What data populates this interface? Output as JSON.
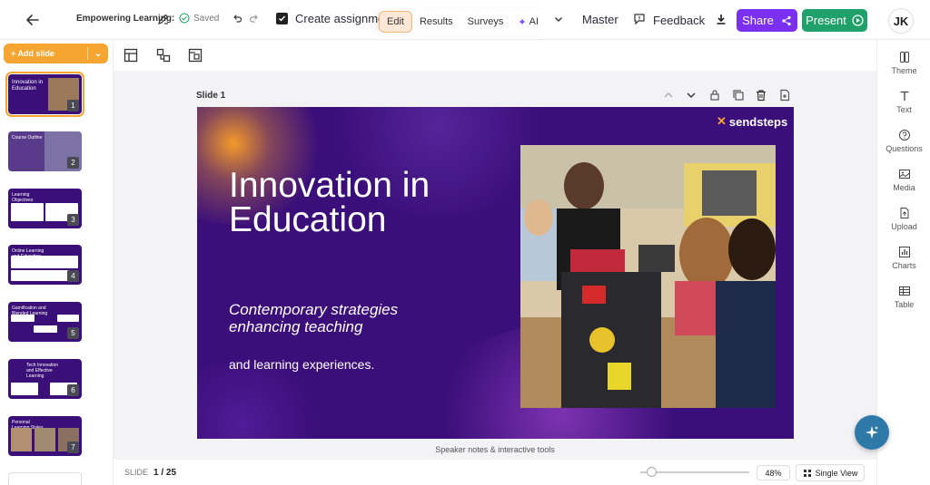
{
  "header": {
    "title": "Empowering Learning:",
    "saved": "Saved",
    "create_assignment": "Create assignment",
    "tabs": [
      {
        "label": "Edit",
        "active": true
      },
      {
        "label": "Results",
        "active": false
      },
      {
        "label": "Surveys",
        "active": false
      },
      {
        "label": "AI",
        "active": false
      }
    ],
    "master": "Master",
    "feedback": "Feedback",
    "share": "Share",
    "present": "Present",
    "avatar_initials": "JK"
  },
  "sidebar": {
    "add_slide": "Add slide",
    "slides": [
      {
        "number": "1",
        "title": "Innovation in Education",
        "selected": true
      },
      {
        "number": "2",
        "title": "Course Outline",
        "selected": false
      },
      {
        "number": "3",
        "title": "Learning Objectives",
        "selected": false
      },
      {
        "number": "4",
        "title": "Online Learning and Education 4.0",
        "selected": false
      },
      {
        "number": "5",
        "title": "Gamification and Blended Learning",
        "selected": false
      },
      {
        "number": "6",
        "title": "Tech Innovation and Effective Learning",
        "selected": false
      },
      {
        "number": "7",
        "title": "Personal Learning Styles",
        "selected": false
      }
    ]
  },
  "slide": {
    "label": "Slide 1",
    "brand": "sendsteps",
    "title": "Innovation in Education",
    "subtitle": "Contemporary strategies enhancing teaching",
    "body": "and learning experiences.",
    "photo": "classroom-photo"
  },
  "footer": {
    "speaker_notes": "Speaker notes & interactive tools",
    "slide_label": "SLIDE",
    "slide_count": "1 / 25",
    "zoom": "48%",
    "zoom_level": 0.1,
    "view": "Single View"
  },
  "right_panel": {
    "items": [
      {
        "label": "Theme",
        "icon": "theme-icon"
      },
      {
        "label": "Text",
        "icon": "text-icon"
      },
      {
        "label": "Questions",
        "icon": "question-icon"
      },
      {
        "label": "Media",
        "icon": "image-icon"
      },
      {
        "label": "Upload",
        "icon": "upload-icon"
      },
      {
        "label": "Charts",
        "icon": "chart-icon"
      },
      {
        "label": "Table",
        "icon": "table-icon"
      }
    ]
  },
  "colors": {
    "accent_orange": "#f7a531",
    "share_purple": "#7b2ff0",
    "present_green": "#20a06a",
    "slide_bg": "#3b0f7a"
  }
}
